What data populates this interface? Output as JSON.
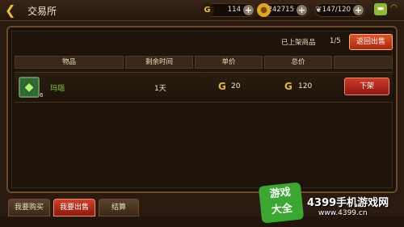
{
  "header": {
    "back_icon": "back-arrow-icon",
    "title": "交易所",
    "resources": {
      "g_coin": "114",
      "gold": "242715",
      "stamina": "147/120"
    }
  },
  "panel": {
    "listed_label": "已上架商品",
    "listed_count": "1/5",
    "return_button": "返回出售",
    "columns": [
      "物品",
      "剩余时间",
      "单价",
      "总价",
      ""
    ],
    "rows": [
      {
        "item_name": "玛瑙",
        "quantity": "6",
        "remaining_time": "1天",
        "unit_price": "20",
        "total_price": "120",
        "action": "下架"
      }
    ]
  },
  "tabs": [
    {
      "label": "我要购买",
      "active": false
    },
    {
      "label": "我要出售",
      "active": true
    },
    {
      "label": "结算",
      "active": false
    }
  ],
  "watermark": {
    "logo_line1": "游戏",
    "logo_line2": "大全",
    "site_name": "4399手机游戏网",
    "url": "www.4399.cn"
  },
  "colors": {
    "accent_red": "#c8301a",
    "item_name_green": "#7ad040",
    "g_coin_gold": "#e8b830"
  }
}
